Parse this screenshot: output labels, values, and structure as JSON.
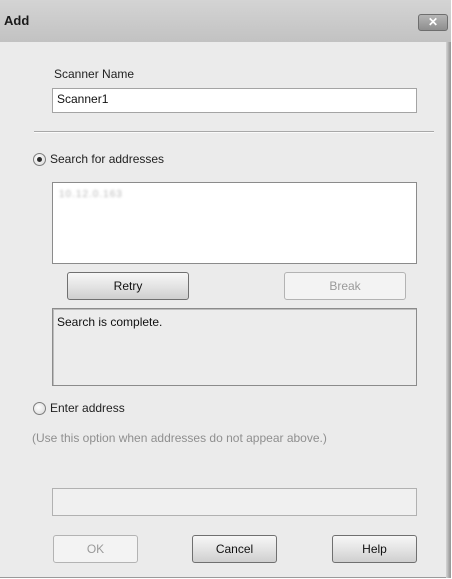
{
  "window": {
    "title": "Add",
    "close_symbol": "✕"
  },
  "scanner_name": {
    "label": "Scanner Name",
    "value": "Scanner1"
  },
  "search": {
    "label": "Search for addresses",
    "selected": true,
    "found_addresses": [
      "10.12.0.163"
    ],
    "retry_label": "Retry",
    "break_label": "Break",
    "status_text": "Search is complete."
  },
  "enter_address": {
    "label": "Enter address",
    "selected": false,
    "hint": "(Use this option when addresses do not appear above.)",
    "value": ""
  },
  "footer": {
    "ok_label": "OK",
    "cancel_label": "Cancel",
    "help_label": "Help"
  }
}
